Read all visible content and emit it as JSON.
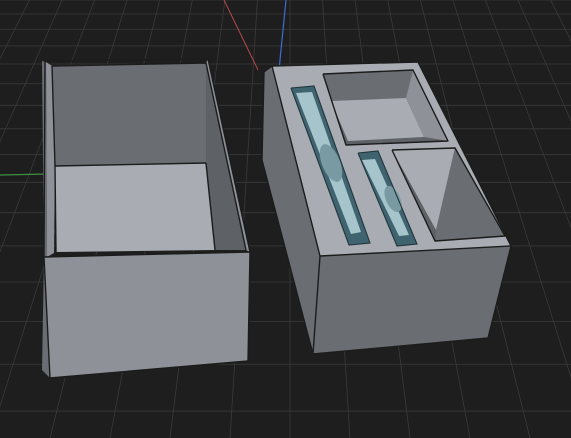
{
  "viewport": {
    "background_color": "#1e1e1e",
    "grid_color": "#3a3a3a"
  },
  "axes": {
    "x_axis_color": "#b24a4a",
    "y_axis_color": "#3f8f47",
    "z_axis_color": "#3a6fd1"
  },
  "models": {
    "lid": {
      "color": "#8e9197"
    },
    "organizer": {
      "color": "#8e9197",
      "slot_color": "#7a9aa3"
    }
  }
}
